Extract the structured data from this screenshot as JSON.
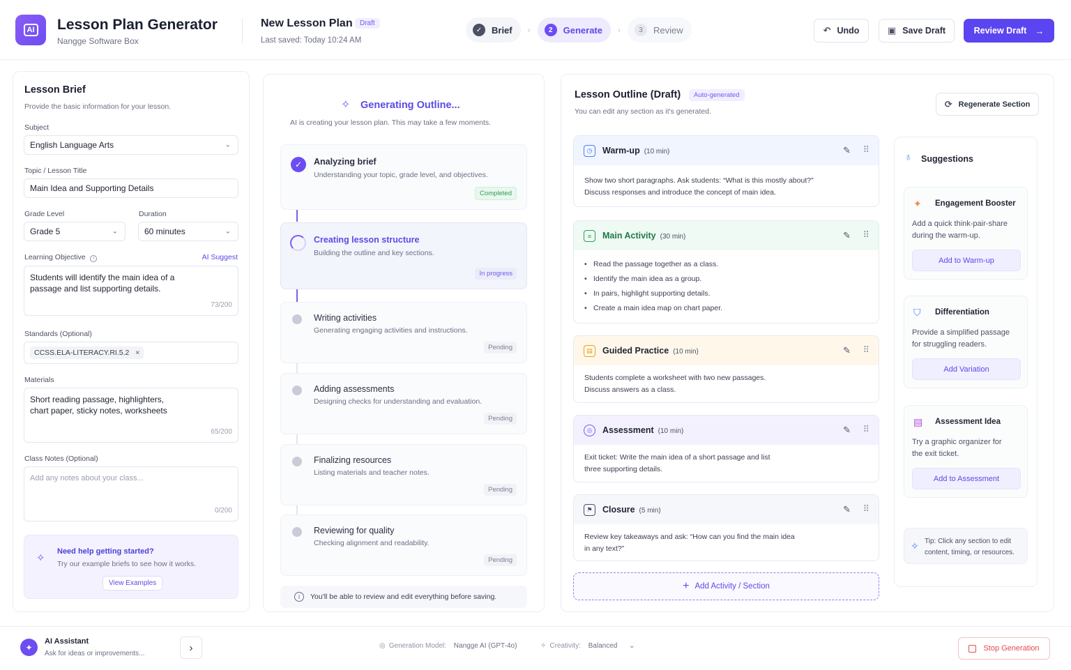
{
  "header": {
    "app_title": "Lesson Plan Generator",
    "app_subtitle": "Nangge Software Box",
    "logo_text": "AI",
    "plan_title": "New Lesson Plan",
    "plan_badge": "Draft",
    "last_saved": "Last saved: Today 10:24 AM",
    "steps": [
      {
        "num": "✓",
        "label": "Brief",
        "state": "done"
      },
      {
        "num": "2",
        "label": "Generate",
        "state": "active"
      },
      {
        "num": "3",
        "label": "Review",
        "state": "todo"
      }
    ],
    "undo_label": "Undo",
    "save_draft_label": "Save Draft",
    "review_draft_label": "Review Draft"
  },
  "brief": {
    "title": "Lesson Brief",
    "subtitle": "Provide the basic information for your lesson.",
    "subject_label": "Subject",
    "subject_value": "English Language Arts",
    "topic_label": "Topic / Lesson Title",
    "topic_value": "Main Idea and Supporting Details",
    "grade_label": "Grade Level",
    "grade_value": "Grade 5",
    "duration_label": "Duration",
    "duration_value": "60 minutes",
    "objective_label": "Learning Objective",
    "ai_suggest": "AI Suggest",
    "objective_line1": "Students will identify the main idea of a",
    "objective_line2": "passage and list supporting details.",
    "objective_count": "73/200",
    "standards_label": "Standards (Optional)",
    "standard_chip": "CCSS.ELA-LITERACY.RI.5.2",
    "materials_label": "Materials",
    "materials_line1": "Short reading passage, highlighters,",
    "materials_line2": "chart paper, sticky notes, worksheets",
    "materials_count": "65/200",
    "notes_label": "Class Notes (Optional)",
    "notes_placeholder": "Add any notes about your class...",
    "notes_count": "0/200",
    "help_title": "Need help getting started?",
    "help_text": "Try our example briefs to see how it works.",
    "help_button": "View Examples"
  },
  "generating": {
    "title": "Generating Outline...",
    "subtitle": "AI is creating your lesson plan. This may take a few moments.",
    "steps": [
      {
        "title": "Analyzing brief",
        "desc": "Understanding your topic, grade level, and objectives.",
        "status": "Completed"
      },
      {
        "title": "Creating lesson structure",
        "desc": "Building the outline and key sections.",
        "status": "In progress"
      },
      {
        "title": "Writing activities",
        "desc": "Generating engaging activities and instructions.",
        "status": "Pending"
      },
      {
        "title": "Adding assessments",
        "desc": "Designing checks for understanding and evaluation.",
        "status": "Pending"
      },
      {
        "title": "Finalizing resources",
        "desc": "Listing materials and teacher notes.",
        "status": "Pending"
      },
      {
        "title": "Reviewing for quality",
        "desc": "Checking alignment and readability.",
        "status": "Pending"
      }
    ],
    "note": "You'll be able to review and edit everything before saving."
  },
  "outline": {
    "title": "Lesson Outline (Draft)",
    "badge": "Auto-generated",
    "subtitle": "You can edit any section as it's generated.",
    "regenerate_label": "Regenerate Section",
    "sections": [
      {
        "name": "Warm-up",
        "time": "(10 min)",
        "line1": "Show two short paragraphs. Ask students: “What is this mostly about?”",
        "line2": "Discuss responses and introduce the concept of main idea."
      },
      {
        "name": "Main Activity",
        "time": "(30 min)",
        "bullets": [
          "Read the passage together as a class.",
          "Identify the main idea as a group.",
          "In pairs, highlight supporting details.",
          "Create a main idea map on chart paper."
        ]
      },
      {
        "name": "Guided Practice",
        "time": "(10 min)",
        "line1": "Students complete a worksheet with two new passages.",
        "line2": "Discuss answers as a class."
      },
      {
        "name": "Assessment",
        "time": "(10 min)",
        "line1": "Exit ticket: Write the main idea of a short passage and list",
        "line2": "three supporting details."
      },
      {
        "name": "Closure",
        "time": "(5 min)",
        "line1": "Review key takeaways and ask: “How can you find the main idea",
        "line2": "in any text?”"
      }
    ],
    "add_label": "Add Activity / Section"
  },
  "suggestions": {
    "title": "Suggestions",
    "items": [
      {
        "title": "Engagement Booster",
        "line1": "Add a quick think-pair-share",
        "line2": "during the warm-up.",
        "button": "Add to Warm-up"
      },
      {
        "title": "Differentiation",
        "line1": "Provide a simplified passage",
        "line2": "for struggling readers.",
        "button": "Add Variation"
      },
      {
        "title": "Assessment Idea",
        "line1": "Try a graphic organizer for",
        "line2": "the exit ticket.",
        "button": "Add to Assessment"
      }
    ],
    "tip_line1": "Tip: Click any section to edit",
    "tip_line2": "content, timing, or resources."
  },
  "footer": {
    "assistant_title": "AI Assistant",
    "assistant_sub": "Ask for ideas or improvements...",
    "model_label": "Generation Model:",
    "model_value": "Nangge AI (GPT-4o)",
    "creativity_label": "Creativity:",
    "creativity_value": "Balanced",
    "stop_label": "Stop Generation"
  },
  "colors": {
    "accent": "#5b45f0",
    "success": "#2f9a58",
    "danger": "#e5484d"
  }
}
